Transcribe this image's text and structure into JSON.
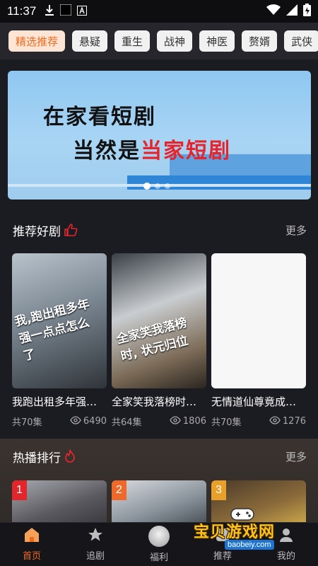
{
  "status_bar": {
    "time": "11:37"
  },
  "categories": [
    {
      "label": "精选推荐",
      "active": true
    },
    {
      "label": "悬疑",
      "active": false
    },
    {
      "label": "重生",
      "active": false
    },
    {
      "label": "战神",
      "active": false
    },
    {
      "label": "神医",
      "active": false
    },
    {
      "label": "赘婿",
      "active": false
    },
    {
      "label": "武侠",
      "active": false
    }
  ],
  "banner": {
    "line1": "在家看短剧",
    "line2_prefix": "当然是",
    "line2_highlight": "当家短剧"
  },
  "recommend": {
    "title": "推荐好剧",
    "more": "更多",
    "items": [
      {
        "title": "我跑出租多年强…",
        "episodes": "共70集",
        "views": "6490",
        "poster_text": "我,跑出租多年 强一点点怎么了"
      },
      {
        "title": "全家笑我落榜时…",
        "episodes": "共64集",
        "views": "1806",
        "poster_text": "全家笑我落榜时, 状元归位"
      },
      {
        "title": "无情道仙尊竟成…",
        "episodes": "共70集",
        "views": "1276",
        "poster_text": ""
      }
    ]
  },
  "hot": {
    "title": "热播排行",
    "more": "更多",
    "ranks": [
      "1",
      "2",
      "3"
    ]
  },
  "bottom_nav": [
    {
      "label": "首页",
      "icon": "home-icon",
      "active": true
    },
    {
      "label": "追剧",
      "icon": "star-icon",
      "active": false
    },
    {
      "label": "福利",
      "icon": "gift-circle-icon",
      "active": false
    },
    {
      "label": "推荐",
      "icon": "recommend-icon",
      "active": false
    },
    {
      "label": "我的",
      "icon": "profile-icon",
      "active": false
    }
  ],
  "watermark": {
    "text": "宝贝游戏网",
    "url": "baobeiy.com"
  },
  "colors": {
    "accent": "#f06a1d",
    "background": "#1b1b22",
    "rank1": "#e3262c",
    "rank2": "#ef6a2a",
    "rank3": "#e8a02a"
  }
}
